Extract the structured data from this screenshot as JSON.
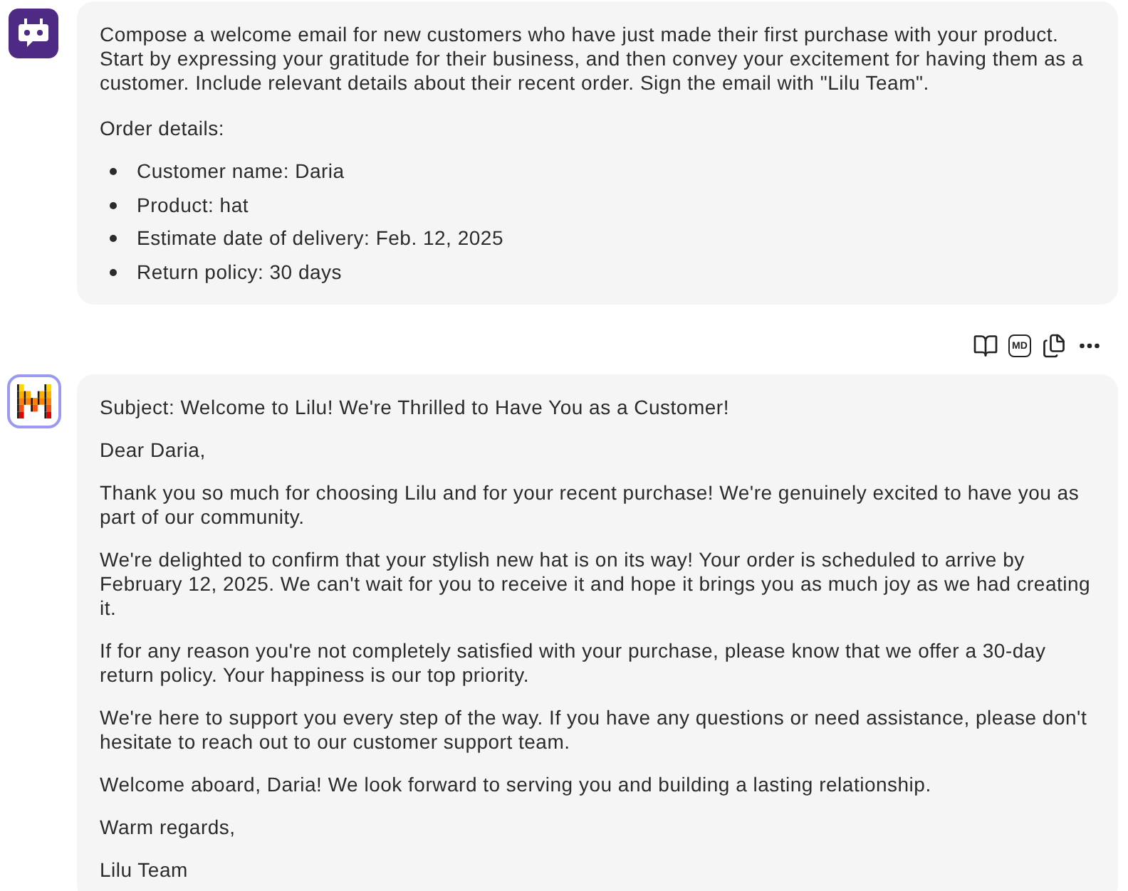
{
  "user_message": {
    "intro": "Compose a welcome email for new customers who have just made their first purchase with your product. Start by expressing your gratitude for their business, and then convey your excitement for having them as a customer. Include relevant details about their recent order. Sign the email with \"Lilu Team\".",
    "order_heading": "Order details:",
    "order_items": [
      "Customer name: Daria",
      "Product: hat",
      "Estimate date of delivery: Feb. 12, 2025",
      "Return policy: 30 days"
    ]
  },
  "toolbar": {
    "markdown_label": "MD"
  },
  "assistant_message": {
    "paragraphs": [
      "Subject: Welcome to Lilu! We're Thrilled to Have You as a Customer!",
      "Dear Daria,",
      "Thank you so much for choosing Lilu and for your recent purchase! We're genuinely excited to have you as part of our community.",
      "We're delighted to confirm that your stylish new hat is on its way! Your order is scheduled to arrive by February 12, 2025. We can't wait for you to receive it and hope it brings you as much joy as we had creating it.",
      "If for any reason you're not completely satisfied with your purchase, please know that we offer a 30-day return policy. Your happiness is our top priority.",
      "We're here to support you every step of the way. If you have any questions or need assistance, please don't hesitate to reach out to our customer support team.",
      "Welcome aboard, Daria! We look forward to serving you and building a lasting relationship.",
      "Warm regards,",
      "Lilu Team"
    ]
  }
}
